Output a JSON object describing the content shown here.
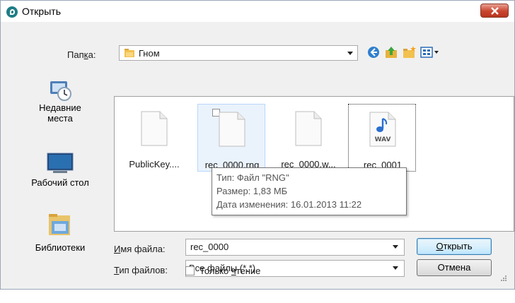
{
  "window": {
    "title": "Открыть"
  },
  "toolbar": {
    "folder_label": "Папка:",
    "folder_value": "Гном",
    "icons": [
      "back-icon",
      "up-folder-icon",
      "new-folder-icon",
      "view-menu-icon"
    ]
  },
  "places": [
    {
      "label_line1": "Недавние",
      "label_line2": "места",
      "icon": "recent-places-icon"
    },
    {
      "label_line1": "Рабочий стол",
      "label_line2": "",
      "icon": "desktop-icon"
    },
    {
      "label_line1": "Библиотеки",
      "label_line2": "",
      "icon": "libraries-icon"
    }
  ],
  "files": [
    {
      "name": "PublicKey....",
      "icon": "document-icon"
    },
    {
      "name": "rec_0000.rng",
      "icon": "document-icon"
    },
    {
      "name": "rec_0000.w...",
      "icon": "document-icon"
    },
    {
      "name": "rec_0001",
      "icon": "wav-audio-icon",
      "badge": "WAV"
    }
  ],
  "tooltip": {
    "type": "Тип: Файл \"RNG\"",
    "size": "Размер: 1,83 МБ",
    "modified": "Дата изменения: 16.01.2013 11:22"
  },
  "form": {
    "filename_label": "Имя файла:",
    "filename_value": "rec_0000",
    "filetype_label": "Тип файлов:",
    "filetype_value": "Все файлы (*.*)",
    "readonly_label": "Только чтение"
  },
  "buttons": {
    "open": "Открыть",
    "cancel": "Отмена"
  },
  "colors": {
    "close_button": "#c9442e",
    "app_icon": "#1f7d86",
    "hover_bg": "#eaf3fc"
  }
}
